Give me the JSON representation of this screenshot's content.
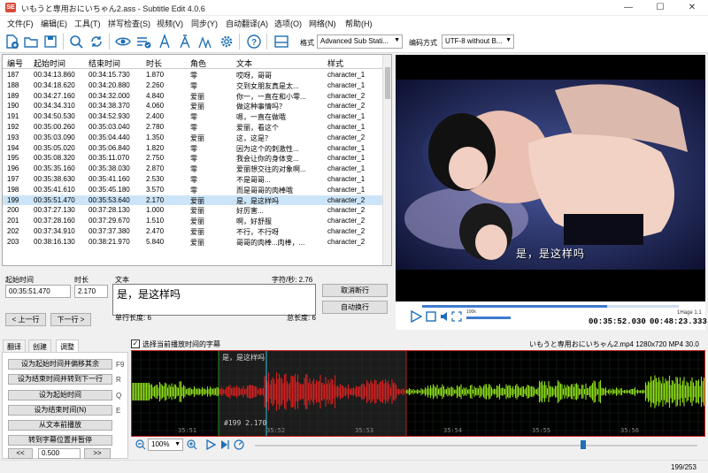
{
  "window": {
    "title": "いもうと専用おにいちゃん2.ass - Subtitle Edit 4.0.6",
    "min": "—",
    "max": "☐",
    "close": "✕"
  },
  "menu": [
    "文件(F)",
    "编辑(E)",
    "工具(T)",
    "拼写检查(S)",
    "视频(V)",
    "同步(Y)",
    "自动翻译(A)",
    "选项(O)",
    "网络(N)",
    "帮助(H)"
  ],
  "toolbar": {
    "format_label": "格式",
    "format_value": "Advanced Sub Stati...",
    "encoding_label": "编码方式",
    "encoding_value": "UTF-8 without B..."
  },
  "grid": {
    "headers": [
      "编号",
      "起始时间",
      "结束时间",
      "时长",
      "角色",
      "文本",
      "样式"
    ],
    "rows": [
      [
        "187",
        "00:34:13.860",
        "00:34:15.730",
        "1.870",
        "零",
        "哎呀，哥哥",
        "character_1"
      ],
      [
        "188",
        "00:34:18.620",
        "00:34:20.880",
        "2.260",
        "零",
        "交到女朋友真是太...",
        "character_1"
      ],
      [
        "189",
        "00:34:27.160",
        "00:34:32.000",
        "4.840",
        "爱丽",
        "你一，一直在和小零...",
        "character_2"
      ],
      [
        "190",
        "00:34:34.310",
        "00:34:38.370",
        "4.060",
        "爱丽",
        "做这种事情吗？",
        "character_2"
      ],
      [
        "191",
        "00:34:50.530",
        "00:34:52.930",
        "2.400",
        "零",
        "嗯，一直在做哦",
        "character_1"
      ],
      [
        "192",
        "00:35:00.260",
        "00:35:03.040",
        "2.780",
        "零",
        "爱丽，看这个",
        "character_1"
      ],
      [
        "193",
        "00:35:03.090",
        "00:35:04.440",
        "1.350",
        "爱丽",
        "这，这是？",
        "character_2"
      ],
      [
        "194",
        "00:35:05.020",
        "00:35:06.840",
        "1.820",
        "零",
        "因为这个的刺激性...",
        "character_1"
      ],
      [
        "195",
        "00:35:08.320",
        "00:35:11.070",
        "2.750",
        "零",
        "我会让你的身体变...",
        "character_1"
      ],
      [
        "196",
        "00:35:35.160",
        "00:35:38.030",
        "2.870",
        "零",
        "爱丽想交往的对象啊...",
        "character_1"
      ],
      [
        "197",
        "00:35:38.630",
        "00:35:41.160",
        "2.530",
        "零",
        "不是哥哥...",
        "character_1"
      ],
      [
        "198",
        "00:35:41.610",
        "00:35:45.180",
        "3.570",
        "零",
        "而是哥哥的肉棒哦",
        "character_1"
      ],
      [
        "199",
        "00:35:51.470",
        "00:35:53.640",
        "2.170",
        "爱丽",
        "是，是这样吗",
        "character_2"
      ],
      [
        "200",
        "00:37:27.130",
        "00:37:28.130",
        "1.000",
        "爱丽",
        "好厉害...",
        "character_2"
      ],
      [
        "201",
        "00:37:28.160",
        "00:37:29.670",
        "1.510",
        "爱丽",
        "啊，好舒服",
        "character_2"
      ],
      [
        "202",
        "00:37:34.910",
        "00:37:37.380",
        "2.470",
        "爱丽",
        "不行，不行呀",
        "character_2"
      ],
      [
        "203",
        "00:38:16.130",
        "00:38:21.970",
        "5.840",
        "爱丽",
        "哥哥的肉棒...肉棒，...",
        "character_2"
      ]
    ],
    "selected_index": 12
  },
  "editor": {
    "start_label": "起始时间",
    "start_value": "00:35:51.470",
    "duration_label": "时长",
    "duration_value": "2.170",
    "text_label": "文本",
    "cps_label": "字符/秒: 2.76",
    "text_value": "是，是这样吗",
    "prev_btn": "< 上一行",
    "next_btn": "下一行 >",
    "single_len": "单行长度: 6",
    "total_len": "总长度: 6",
    "unbreak_btn": "取消断行",
    "autobreak_btn": "自动换行"
  },
  "video": {
    "subtitle": "是，是这样吗",
    "current_time": "00:35:52.030",
    "total_time": "00:48:23.333",
    "volume_label": "100k",
    "frame_label": "1Hage 1.1"
  },
  "tabs": [
    "翻译",
    "创建",
    "调整"
  ],
  "adjust": {
    "buttons": [
      {
        "label": "设为起始时间并偏移其余",
        "key": "F9"
      },
      {
        "label": "设为结束时间并转到下一行",
        "key": "R"
      },
      {
        "label": "设为起始时间",
        "key": "Q"
      },
      {
        "label": "设为结束时间(N)",
        "key": "E"
      },
      {
        "label": "从文本前播放",
        "key": ""
      },
      {
        "label": "转到字幕位置并暂停",
        "key": ""
      }
    ],
    "step_left": "<<",
    "step_value": "0.500",
    "step_right": ">>"
  },
  "wave": {
    "checkbox_label": "选择当前播放时间的字幕",
    "file_info": "いもうと専用おにいちゃん2.mp4 1280x720 MP4 30.0",
    "sub_text": "是，是这样吗",
    "sub_info": "#199  2.170",
    "ticks": [
      "35:51",
      "35:52",
      "35:53",
      "35:54",
      "35:55",
      "35:56"
    ],
    "zoom": "100%"
  },
  "status": "199/253"
}
